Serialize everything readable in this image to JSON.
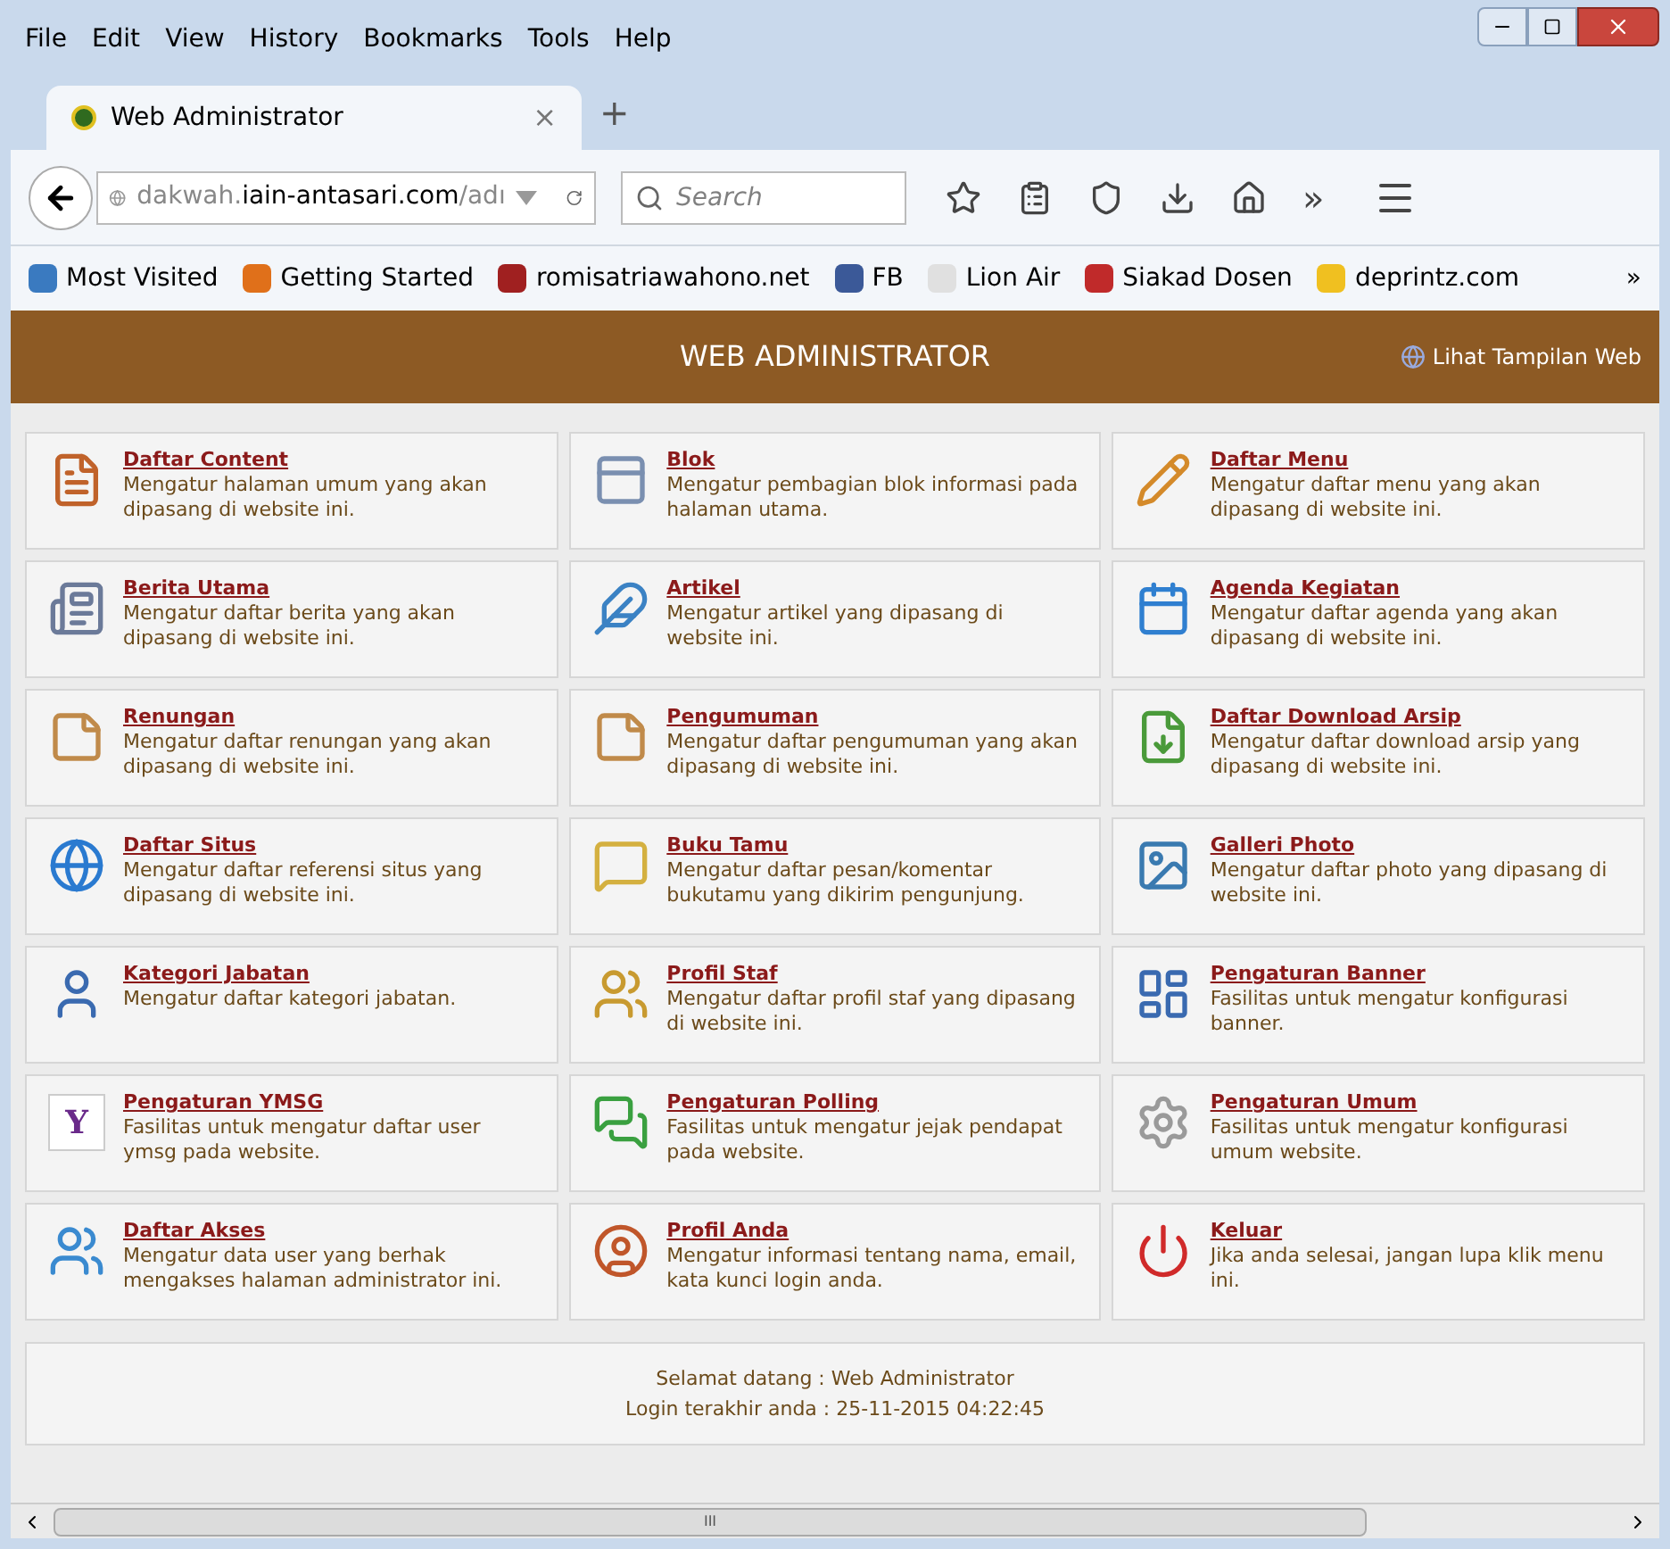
{
  "menu_bar": [
    "File",
    "Edit",
    "View",
    "History",
    "Bookmarks",
    "Tools",
    "Help"
  ],
  "tabs": [
    {
      "label": "Web Administrator",
      "selected": true,
      "close": "×"
    }
  ],
  "new_tab": "+",
  "address_bar": {
    "domain_prefix": "dakwah.",
    "domain": "iain-antasari.com",
    "path": "/adı"
  },
  "search": {
    "placeholder": "Search"
  },
  "overflow": "»",
  "bookmarks": [
    "Most Visited",
    "Getting Started",
    "romisatriawahono.net",
    "FB",
    "Lion Air",
    "Siakad Dosen",
    "deprintz.com"
  ],
  "bookmarks_overflow": "»",
  "header": {
    "title": "WEB ADMINISTRATOR",
    "link": "Lihat Tampilan Web"
  },
  "tiles": [
    {
      "title": "Daftar Content",
      "description": "Mengatur halaman umum yang akan dipasang di website ini."
    },
    {
      "title": "Blok",
      "description": "Mengatur pembagian blok informasi pada halaman utama."
    },
    {
      "title": "Daftar Menu",
      "description": "Mengatur daftar menu yang akan dipasang di website ini."
    },
    {
      "title": "Berita Utama",
      "description": "Mengatur daftar berita yang akan dipasang di website ini."
    },
    {
      "title": "Artikel",
      "description": "Mengatur artikel yang dipasang di website ini."
    },
    {
      "title": "Agenda Kegiatan",
      "description": "Mengatur daftar agenda yang akan dipasang di website ini."
    },
    {
      "title": "Renungan",
      "description": "Mengatur daftar renungan yang akan dipasang di website ini."
    },
    {
      "title": "Pengumuman",
      "description": "Mengatur daftar pengumuman yang akan dipasang di website ini."
    },
    {
      "title": "Daftar Download Arsip",
      "description": "Mengatur daftar download arsip yang dipasang di website ini."
    },
    {
      "title": "Daftar Situs",
      "description": "Mengatur daftar referensi situs yang dipasang di website ini."
    },
    {
      "title": "Buku Tamu",
      "description": "Mengatur daftar pesan/komentar bukutamu yang dikirim pengunjung."
    },
    {
      "title": "Galleri Photo",
      "description": "Mengatur daftar photo yang dipasang di website ini."
    },
    {
      "title": "Kategori Jabatan",
      "description": "Mengatur daftar kategori jabatan."
    },
    {
      "title": "Profil Staf",
      "description": "Mengatur daftar profil staf yang dipasang di website ini."
    },
    {
      "title": "Pengaturan Banner",
      "description": "Fasilitas untuk mengatur konfigurasi banner."
    },
    {
      "title": "Pengaturan YMSG",
      "description": "Fasilitas untuk mengatur daftar user ymsg pada website.",
      "icon_text": "Y"
    },
    {
      "title": "Pengaturan Polling",
      "description": "Fasilitas untuk mengatur jejak pendapat pada website."
    },
    {
      "title": "Pengaturan Umum",
      "description": "Fasilitas untuk mengatur konfigurasi umum website."
    },
    {
      "title": "Daftar Akses",
      "description": "Mengatur data user yang berhak mengakses halaman administrator ini."
    },
    {
      "title": "Profil Anda",
      "description": "Mengatur informasi tentang nama, email, kata kunci login anda."
    },
    {
      "title": "Keluar",
      "description": "Jika anda selesai, jangan lupa klik menu ini."
    }
  ],
  "footer": [
    "Selamat datang : Web Administrator",
    "Login terakhir anda : 25-11-2015 04:22:45"
  ],
  "scrollbar_grip": "III"
}
